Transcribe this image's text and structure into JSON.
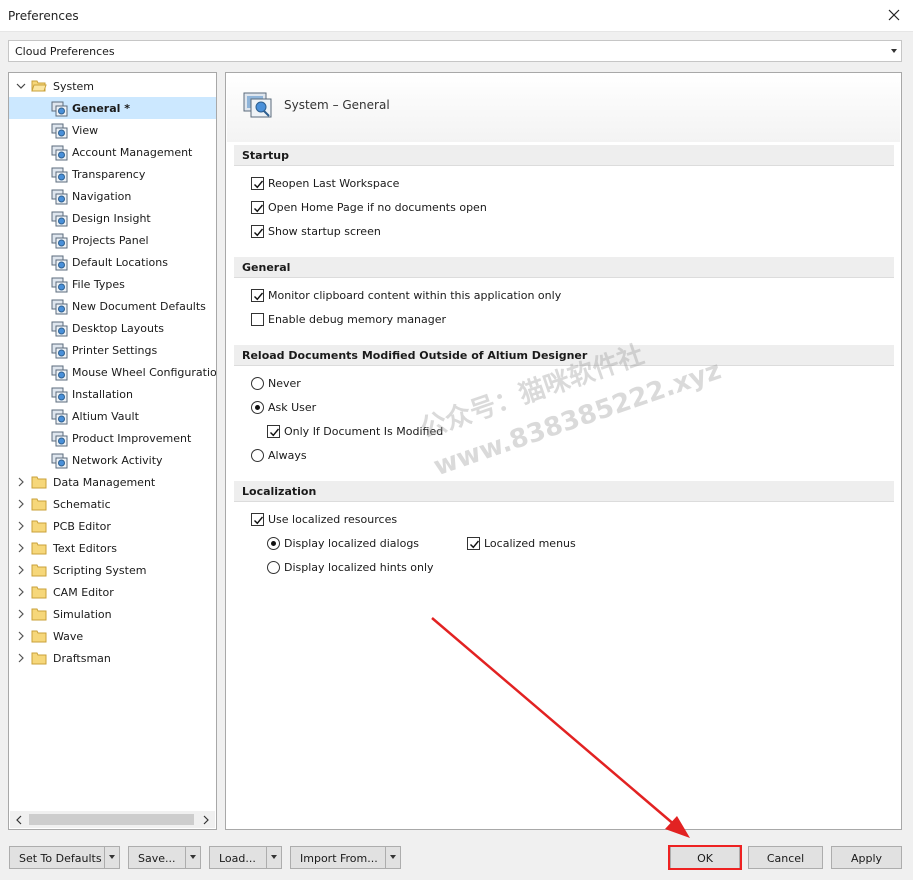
{
  "window": {
    "title": "Preferences"
  },
  "profile": {
    "selected": "Cloud Preferences"
  },
  "tree": {
    "system_label": "System",
    "system_children": [
      "General *",
      "View",
      "Account Management",
      "Transparency",
      "Navigation",
      "Design Insight",
      "Projects Panel",
      "Default Locations",
      "File Types",
      "New Document Defaults",
      "Desktop Layouts",
      "Printer Settings",
      "Mouse Wheel Configuration",
      "Installation",
      "Altium Vault",
      "Product Improvement",
      "Network Activity"
    ],
    "other_folders": [
      "Data Management",
      "Schematic",
      "PCB Editor",
      "Text Editors",
      "Scripting System",
      "CAM Editor",
      "Simulation",
      "Wave",
      "Draftsman"
    ]
  },
  "page": {
    "title": "System – General",
    "sections": {
      "startup": "Startup",
      "general": "General",
      "reload": "Reload Documents Modified Outside of Altium Designer",
      "localization": "Localization"
    },
    "startup_options": [
      {
        "label": "Reopen Last Workspace",
        "checked": true
      },
      {
        "label": "Open Home Page if no documents open",
        "checked": true
      },
      {
        "label": "Show startup screen",
        "checked": true
      }
    ],
    "general_options": [
      {
        "label": "Monitor clipboard content within this application only",
        "checked": true
      },
      {
        "label": "Enable debug memory manager",
        "checked": false
      }
    ],
    "reload_options": {
      "never": "Never",
      "ask_user": "Ask User",
      "only_if_modified": "Only If Document Is Modified",
      "always": "Always",
      "selected": "ask_user",
      "only_if_modified_checked": true
    },
    "localization": {
      "use_localized": "Use localized resources",
      "use_localized_checked": true,
      "display_dialogs": "Display localized dialogs",
      "display_hints": "Display localized hints only",
      "localized_menus": "Localized menus",
      "selected": "dialogs",
      "menus_checked": true
    }
  },
  "watermark": {
    "line1": "公众号：猫咪软件社",
    "line2": "www.838385222.xyz"
  },
  "buttons": {
    "set_defaults": "Set To Defaults",
    "save": "Save...",
    "load": "Load...",
    "import_from": "Import From...",
    "ok": "OK",
    "cancel": "Cancel",
    "apply": "Apply"
  },
  "colors": {
    "selection": "#cce8ff",
    "annotation_red": "#e22222"
  }
}
